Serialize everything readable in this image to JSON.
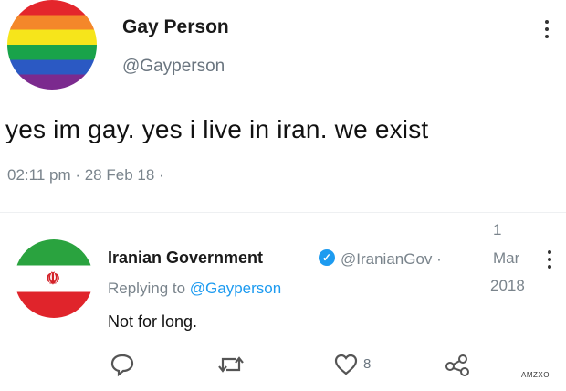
{
  "tweet": {
    "display_name": "Gay Person",
    "handle": "@Gayperson",
    "text": "yes im gay. yes i live in iran. we exist",
    "timestamp": "02:11 pm · 28 Feb 18 ·",
    "avatar": "rainbow-flag",
    "menu_icon": "more-vertical-icon"
  },
  "reply": {
    "display_name": "Iranian Government",
    "handle": "@IranianGov",
    "separator": "·",
    "date_day": "1",
    "date_month": "Mar",
    "date_year": "2018",
    "replying_label": "Replying to",
    "replying_mention": "@Gayperson",
    "text": "Not for long.",
    "avatar": "iran-flag",
    "emblem": "☫",
    "verified_icon": "✓",
    "like_count": "8"
  },
  "watermark": "AMZXO",
  "colors": {
    "link": "#1d9bf0",
    "muted": "#7a848c",
    "text": "#111111"
  }
}
